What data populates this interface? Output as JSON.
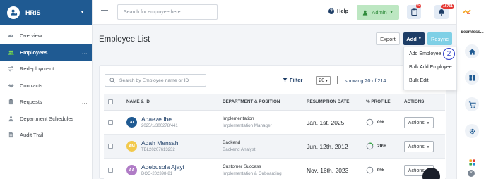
{
  "sidebar": {
    "brand": "HRIS",
    "items": [
      {
        "label": "Overview",
        "active": false,
        "dots": ""
      },
      {
        "label": "Employees",
        "active": true,
        "dots": "..."
      },
      {
        "label": "Redeployment",
        "active": false,
        "dots": "..."
      },
      {
        "label": "Contracts",
        "active": false,
        "dots": "..."
      },
      {
        "label": "Requests",
        "active": false,
        "dots": "..."
      },
      {
        "label": "Department Schedules",
        "active": false,
        "dots": ""
      },
      {
        "label": "Audit Trail",
        "active": false,
        "dots": ""
      }
    ]
  },
  "topbar": {
    "search_placeholder": "Search for employee here",
    "help_label": "Help",
    "role_label": "Admin",
    "clipboard_badge": "5",
    "notifications_badge": "16751"
  },
  "rail": {
    "label": "Seamless..."
  },
  "main": {
    "title": "Employee List",
    "export_label": "Export",
    "add_label": "Add",
    "resync_label": "Resync",
    "add_menu": [
      "Add Employee",
      "Bulk Add Employee",
      "Bulk Edit"
    ],
    "step_marker": "2",
    "search_placeholder": "Search by Employee name or ID",
    "filter_label": "Filter",
    "page_size": "20",
    "showing_text": "showing 20 of 214",
    "columns": [
      "NAME & ID",
      "DEPARTMENT & POSITION",
      "RESUMPTION DATE",
      "% PROFILE",
      "ACTIONS"
    ],
    "rows": [
      {
        "initials": "AI",
        "avatar_color": "#1f5a92",
        "name": "Adaeze Ibe",
        "id": "2025/1/300278/441",
        "dept": "Implementation",
        "position": "Implementation Manager",
        "date": "Jan. 1st, 2025",
        "profile": 0,
        "profile_text": "0%",
        "action": "Actions"
      },
      {
        "initials": "AM",
        "avatar_color": "#f2c94c",
        "name": "Adah Mensah",
        "id": "TBL20207613232",
        "dept": "Backend",
        "position": "Backend Analyst",
        "date": "Jun. 12th, 2012",
        "profile": 20,
        "profile_text": "20%",
        "action": "Actions"
      },
      {
        "initials": "AA",
        "avatar_color": "#b07cc6",
        "name": "Adebusola Ajayi",
        "id": "DOC-202398-81",
        "dept": "Customer Success",
        "position": "Implementation & Onboarding",
        "date": "Nov. 16th, 2023",
        "profile": 0,
        "profile_text": "0%",
        "action": "Actions"
      }
    ]
  },
  "colors": {
    "brand": "#1f5a92",
    "navy": "#1d3d66",
    "admin_bg": "#bde7c2",
    "resync": "#7fd0e6",
    "badge": "#e53935",
    "progress": "#3aa84a"
  }
}
